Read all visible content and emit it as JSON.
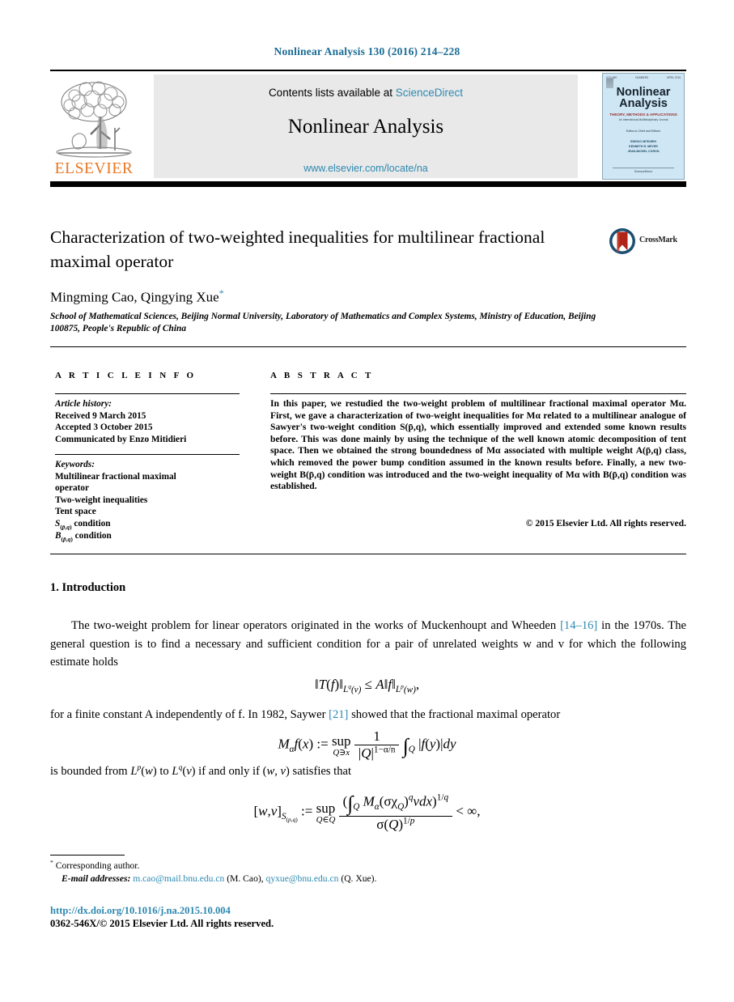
{
  "running_head": "Nonlinear Analysis 130 (2016) 214–228",
  "masthead": {
    "contents_prefix": "Contents lists available at ",
    "sciencedirect": "ScienceDirect",
    "journal_name": "Nonlinear Analysis",
    "journal_url": "www.elsevier.com/locate/na",
    "publisher_wordmark": "ELSEVIER",
    "publisher_color": "#E87722",
    "link_color": "#2e89b0"
  },
  "cover": {
    "corner_left": "VOLUME",
    "corner_mid": "NUMBERS",
    "corner_right": "APRIL 2015",
    "title_line1": "Nonlinear",
    "title_line2": "Analysis",
    "subtitle": "THEORY, METHODS & APPLICATIONS",
    "subtitle2": "An International Multidisciplinary Journal",
    "editors_label": "Editor-in-Chief and Editors",
    "editors": "ENRICO MITIDIERI\nKENNETH R. MEYER\nJEAN-MICHEL CORON",
    "footer": "ScienceDirect"
  },
  "article": {
    "title": "Characterization of two-weighted inequalities for multilinear fractional maximal operator",
    "crossmark_label": "CrossMark",
    "authors": "Mingming Cao, Qingying Xue",
    "corresponding_marker": "*",
    "affiliation": "School of Mathematical Sciences, Beijing Normal University, Laboratory of Mathematics and Complex Systems, Ministry of Education, Beijing 100875, People's Republic of China"
  },
  "info": {
    "heading": "A R T I C L E   I N F O",
    "history_label": "Article history:",
    "history": [
      "Received 9 March 2015",
      "Accepted 3 October 2015",
      "Communicated by Enzo Mitidieri"
    ],
    "keywords_label": "Keywords:",
    "keywords": [
      "Multilinear fractional maximal operator",
      "Two-weight inequalities",
      "Tent space",
      "S(p̄,q) condition",
      "B(p̄,q) condition"
    ]
  },
  "abstract": {
    "heading": "A B S T R A C T",
    "text": "In this paper, we restudied the two-weight problem of multilinear fractional maximal operator Mα. First, we gave a characterization of two-weight inequalities for Mα related to a multilinear analogue of Sawyer's two-weight condition S(p̄,q), which essentially improved and extended some known results before. This was done mainly by using the technique of the well known atomic decomposition of tent space. Then we obtained the strong boundedness of Mα associated with multiple weight A(p̄,q) class, which removed the power bump condition assumed in the known results before. Finally, a new two-weight B(p̄,q) condition was introduced and the two-weight inequality of Mα with B(p̄,q) condition was established.",
    "copyright": "© 2015 Elsevier Ltd. All rights reserved."
  },
  "body": {
    "section_heading": "1. Introduction",
    "para1_a": "The two-weight problem for linear operators originated in the works of Muckenhoupt and Wheeden ",
    "para1_ref": "[14–16]",
    "para1_b": " in the 1970s. The general question is to find a necessary and sufficient condition for a pair of unrelated weights w and v for which the following estimate holds",
    "para2_a": "for a finite constant A independently of f. In 1982, Saywer ",
    "para2_ref": "[21]",
    "para2_b": " showed that the fractional maximal operator",
    "para3": "is bounded from Lp(w) to Lq(v) if and only if (w, v) satisfies that"
  },
  "footnotes": {
    "star": "*",
    "corresponding": "Corresponding author.",
    "email_label": "E-mail addresses:",
    "email1": "m.cao@mail.bnu.edu.cn",
    "email1_who": "(M. Cao),",
    "email2": "qyxue@bnu.edu.cn",
    "email2_who": "(Q. Xue).",
    "doi": "http://dx.doi.org/10.1016/j.na.2015.10.004",
    "issn_line": "0362-546X/© 2015 Elsevier Ltd. All rights reserved."
  }
}
